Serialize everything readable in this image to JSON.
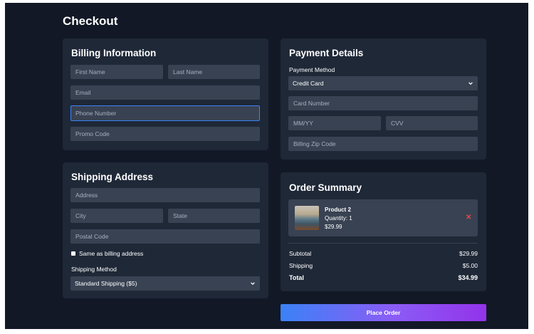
{
  "page": {
    "title": "Checkout"
  },
  "billing": {
    "title": "Billing Information",
    "first_name_placeholder": "First Name",
    "last_name_placeholder": "Last Name",
    "email_placeholder": "Email",
    "phone_placeholder": "Phone Number",
    "promo_placeholder": "Promo Code"
  },
  "shipping": {
    "title": "Shipping Address",
    "address_placeholder": "Address",
    "city_placeholder": "City",
    "state_placeholder": "State",
    "postal_placeholder": "Postal Code",
    "same_as_billing_label": "Same as billing address",
    "method_label": "Shipping Method",
    "method_selected": "Standard Shipping ($5)"
  },
  "payment": {
    "title": "Payment Details",
    "method_label": "Payment Method",
    "method_selected": "Credit Card",
    "card_number_placeholder": "Card Number",
    "expiry_placeholder": "MM/YY",
    "cvv_placeholder": "CVV",
    "zip_placeholder": "Billing Zip Code"
  },
  "summary": {
    "title": "Order Summary",
    "item": {
      "name": "Product 2",
      "quantity": "Quantity: 1",
      "price": "$29.99",
      "remove_glyph": "✕"
    },
    "subtotal_label": "Subtotal",
    "subtotal_value": "$29.99",
    "shipping_label": "Shipping",
    "shipping_value": "$5.00",
    "total_label": "Total",
    "total_value": "$34.99"
  },
  "actions": {
    "place_order_label": "Place Order"
  },
  "colors": {
    "background": "#121826",
    "card": "#1f2837",
    "field": "#384252",
    "accent": "#3b82f6",
    "button_end": "#9333ea",
    "remove": "#ef4444"
  },
  "icons": {
    "select_chevron": "chevron-down-icon",
    "remove": "close-icon"
  }
}
